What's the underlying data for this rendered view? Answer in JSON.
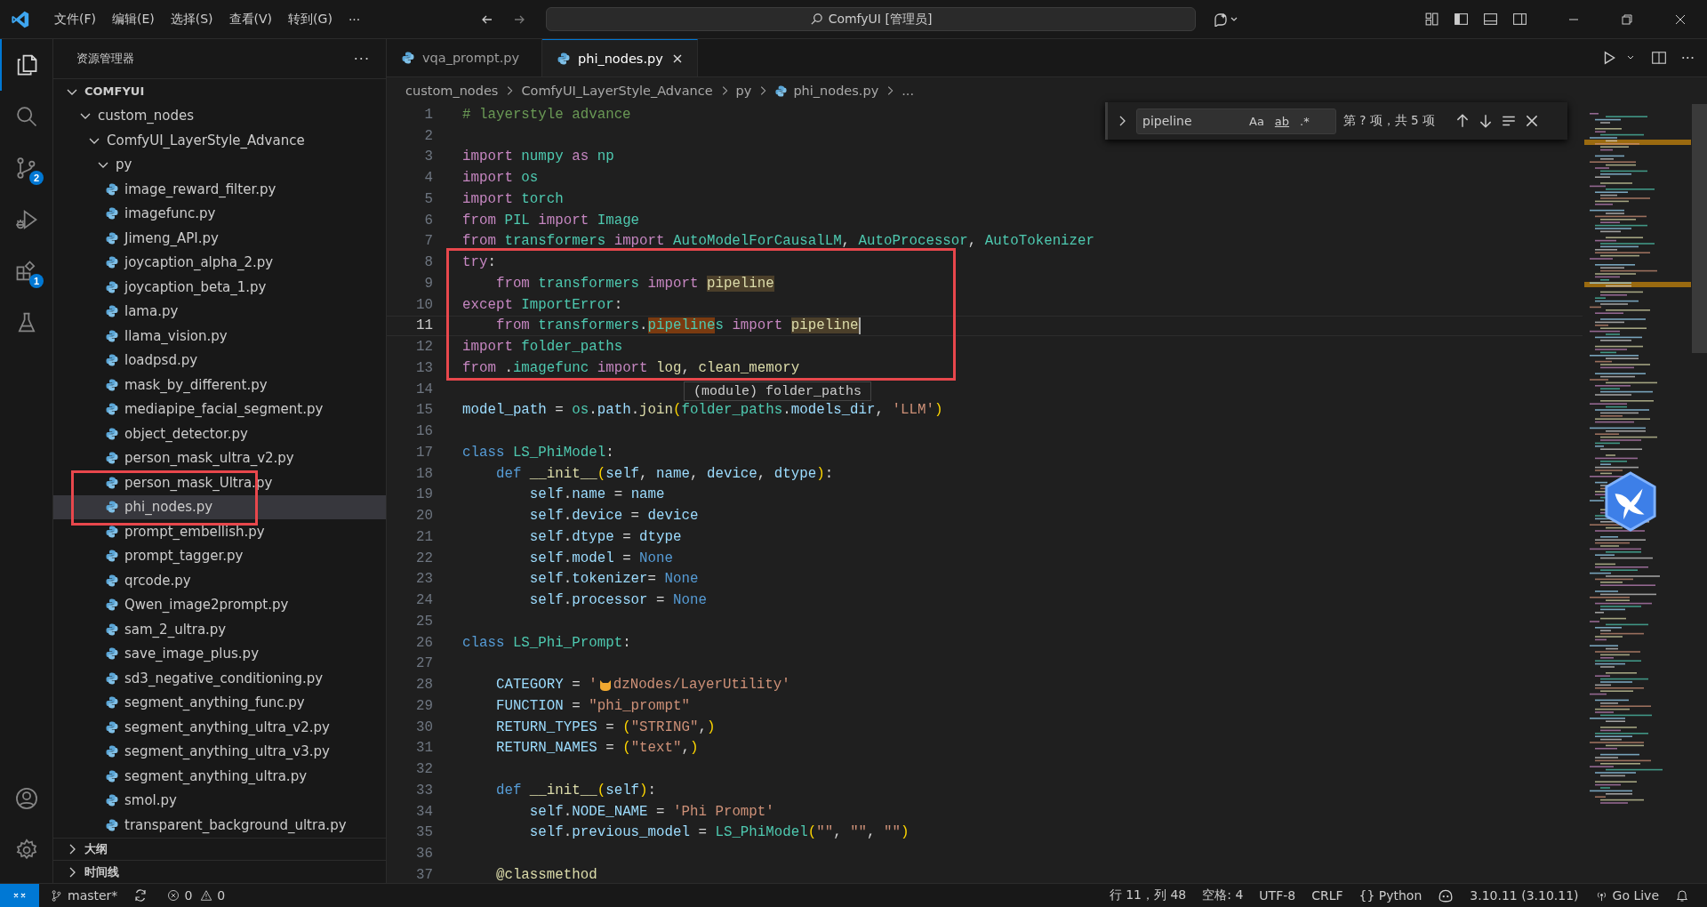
{
  "title_bar": {
    "menus": [
      "文件(F)",
      "编辑(E)",
      "选择(S)",
      "查看(V)",
      "转到(G)"
    ],
    "more": "···",
    "search": "ComfyUI [管理员]"
  },
  "activity_bar": {
    "items": [
      {
        "kind": "explorer",
        "selected": true
      },
      {
        "kind": "search",
        "selected": false
      },
      {
        "kind": "source-control",
        "selected": false,
        "badge": "2"
      },
      {
        "kind": "run-debug",
        "selected": false
      },
      {
        "kind": "extensions",
        "selected": false,
        "badge": "1"
      },
      {
        "kind": "testing",
        "selected": false
      }
    ],
    "bottom": [
      {
        "kind": "account"
      },
      {
        "kind": "settings"
      }
    ]
  },
  "sidebar": {
    "title": "资源管理器",
    "more": "···",
    "tree": [
      {
        "label": "COMFYUI",
        "expanded": true,
        "children": [
          {
            "label": "custom_nodes",
            "expanded": true,
            "children": [
              {
                "label": "ComfyUI_LayerStyle_Advance",
                "expanded": true,
                "children": [
                  {
                    "label": "py",
                    "expanded": true,
                    "children": [
                      {
                        "label": "image_reward_filter.py",
                        "selected": false
                      },
                      {
                        "label": "imagefunc.py",
                        "selected": false
                      },
                      {
                        "label": "Jimeng_API.py",
                        "selected": false
                      },
                      {
                        "label": "joycaption_alpha_2.py",
                        "selected": false
                      },
                      {
                        "label": "joycaption_beta_1.py",
                        "selected": false
                      },
                      {
                        "label": "lama.py",
                        "selected": false
                      },
                      {
                        "label": "llama_vision.py",
                        "selected": false
                      },
                      {
                        "label": "loadpsd.py",
                        "selected": false
                      },
                      {
                        "label": "mask_by_different.py",
                        "selected": false
                      },
                      {
                        "label": "mediapipe_facial_segment.py",
                        "selected": false
                      },
                      {
                        "label": "object_detector.py",
                        "selected": false
                      },
                      {
                        "label": "person_mask_ultra_v2.py",
                        "selected": false
                      },
                      {
                        "label": "person_mask_Ultra.py",
                        "selected": false
                      },
                      {
                        "label": "phi_nodes.py",
                        "selected": true
                      },
                      {
                        "label": "prompt_embellish.py",
                        "selected": false
                      },
                      {
                        "label": "prompt_tagger.py",
                        "selected": false
                      },
                      {
                        "label": "qrcode.py",
                        "selected": false
                      },
                      {
                        "label": "Qwen_image2prompt.py",
                        "selected": false
                      },
                      {
                        "label": "sam_2_ultra.py",
                        "selected": false
                      },
                      {
                        "label": "save_image_plus.py",
                        "selected": false
                      },
                      {
                        "label": "sd3_negative_conditioning.py",
                        "selected": false
                      },
                      {
                        "label": "segment_anything_func.py",
                        "selected": false
                      },
                      {
                        "label": "segment_anything_ultra_v2.py",
                        "selected": false
                      },
                      {
                        "label": "segment_anything_ultra_v3.py",
                        "selected": false
                      },
                      {
                        "label": "segment_anything_ultra.py",
                        "selected": false
                      },
                      {
                        "label": "smol.py",
                        "selected": false
                      },
                      {
                        "label": "transparent_background_ultra.py",
                        "selected": false
                      }
                    ]
                  }
                ]
              }
            ]
          }
        ]
      }
    ],
    "sections": [
      {
        "label": "大纲",
        "expanded": false
      },
      {
        "label": "时间线",
        "expanded": false
      }
    ]
  },
  "editor": {
    "tabs": [
      {
        "label": "vqa_prompt.py",
        "selected": false
      },
      {
        "label": "phi_nodes.py",
        "selected": true
      }
    ],
    "actions_more": "···",
    "breadcrumbs": [
      {
        "label": "custom_nodes",
        "kind": "folder"
      },
      {
        "label": "ComfyUI_LayerStyle_Advance",
        "kind": "folder"
      },
      {
        "label": "py",
        "kind": "folder"
      },
      {
        "label": "phi_nodes.py",
        "kind": "file"
      },
      {
        "label": "...",
        "kind": "more"
      }
    ],
    "find": {
      "value": "pipeline",
      "options": [
        {
          "label": "Aa",
          "on": false
        },
        {
          "label": "ab",
          "on": false
        },
        {
          "label": ".*",
          "on": false
        }
      ],
      "result": "第 ? 项，共 5 项"
    },
    "lines": [
      {
        "number": "1",
        "current": false,
        "tokens": [
          {
            "kind": "comment",
            "text": "# layerstyle advance"
          }
        ]
      },
      {
        "number": "2",
        "current": false
      },
      {
        "number": "3",
        "current": false,
        "tokens": [
          {
            "kind": "keyword",
            "text": "import "
          },
          {
            "kind": "type",
            "text": "numpy "
          },
          {
            "kind": "keyword",
            "text": "as "
          },
          {
            "kind": "type",
            "text": "np"
          }
        ]
      },
      {
        "number": "4",
        "current": false,
        "tokens": [
          {
            "kind": "keyword",
            "text": "import "
          },
          {
            "kind": "type",
            "text": "os"
          }
        ]
      },
      {
        "number": "5",
        "current": false,
        "tokens": [
          {
            "kind": "keyword",
            "text": "import "
          },
          {
            "kind": "type",
            "text": "torch"
          }
        ]
      },
      {
        "number": "6",
        "current": false,
        "tokens": [
          {
            "kind": "keyword",
            "text": "from "
          },
          {
            "kind": "type",
            "text": "PIL "
          },
          {
            "kind": "keyword",
            "text": "import "
          },
          {
            "kind": "type",
            "text": "Image"
          }
        ]
      },
      {
        "number": "7",
        "current": false,
        "tokens": [
          {
            "kind": "keyword",
            "text": "from "
          },
          {
            "kind": "type",
            "text": "transformers "
          },
          {
            "kind": "keyword",
            "text": "import "
          },
          {
            "kind": "type",
            "text": "AutoModelForCausalLM"
          },
          {
            "kind": "plain",
            "text": ", "
          },
          {
            "kind": "type",
            "text": "AutoProcessor"
          },
          {
            "kind": "plain",
            "text": ", "
          },
          {
            "kind": "type",
            "text": "AutoTokenizer"
          }
        ]
      },
      {
        "number": "8",
        "current": false,
        "tokens": [
          {
            "kind": "keyword",
            "text": "try"
          },
          {
            "kind": "plain",
            "text": ":"
          }
        ]
      },
      {
        "number": "9",
        "current": false,
        "tokens": [
          {
            "kind": "keyword",
            "text": "    from "
          },
          {
            "kind": "type",
            "text": "transformers "
          },
          {
            "kind": "keyword",
            "text": "import "
          },
          {
            "kind": "match",
            "text": "pipeline"
          }
        ]
      },
      {
        "number": "10",
        "current": false,
        "tokens": [
          {
            "kind": "keyword",
            "text": "except "
          },
          {
            "kind": "type",
            "text": "ImportError"
          },
          {
            "kind": "plain",
            "text": ":"
          }
        ]
      },
      {
        "number": "11",
        "current": true,
        "tokens": [
          {
            "kind": "keyword",
            "text": "    from "
          },
          {
            "kind": "type",
            "text": "transformers"
          },
          {
            "kind": "plain",
            "text": "."
          },
          {
            "kind": "current-match",
            "text": "pipeline"
          },
          {
            "kind": "type",
            "text": "s "
          },
          {
            "kind": "keyword",
            "text": "import "
          },
          {
            "kind": "match",
            "text": "pipeline"
          }
        ]
      },
      {
        "number": "12",
        "current": false,
        "tokens": [
          {
            "kind": "keyword",
            "text": "import "
          },
          {
            "kind": "type",
            "text": "folder_paths"
          }
        ]
      },
      {
        "number": "13",
        "current": false,
        "tokens": [
          {
            "kind": "keyword",
            "text": "from "
          },
          {
            "kind": "plain",
            "text": "."
          },
          {
            "kind": "type",
            "text": "imagefunc "
          },
          {
            "kind": "keyword",
            "text": "import "
          },
          {
            "kind": "function",
            "text": "log"
          },
          {
            "kind": "plain",
            "text": ", "
          },
          {
            "kind": "function",
            "text": "clean_memory"
          }
        ]
      },
      {
        "number": "14",
        "current": false
      },
      {
        "number": "15",
        "current": false,
        "tokens": [
          {
            "kind": "variable",
            "text": "model_path"
          },
          {
            "kind": "plain",
            "text": " = "
          },
          {
            "kind": "type",
            "text": "os"
          },
          {
            "kind": "plain",
            "text": "."
          },
          {
            "kind": "variable",
            "text": "path"
          },
          {
            "kind": "plain",
            "text": "."
          },
          {
            "kind": "function",
            "text": "join"
          },
          {
            "kind": "bracket",
            "text": "("
          },
          {
            "kind": "type",
            "text": "folder_paths"
          },
          {
            "kind": "plain",
            "text": "."
          },
          {
            "kind": "variable",
            "text": "models_dir"
          },
          {
            "kind": "plain",
            "text": ", "
          },
          {
            "kind": "string",
            "text": "'LLM'"
          },
          {
            "kind": "bracket",
            "text": ")"
          }
        ]
      },
      {
        "number": "16",
        "current": false
      },
      {
        "number": "17",
        "current": false,
        "tokens": [
          {
            "kind": "storage",
            "text": "class "
          },
          {
            "kind": "type",
            "text": "LS_PhiModel"
          },
          {
            "kind": "plain",
            "text": ":"
          }
        ]
      },
      {
        "number": "18",
        "current": false,
        "tokens": [
          {
            "kind": "storage",
            "text": "    def "
          },
          {
            "kind": "function",
            "text": "__init__"
          },
          {
            "kind": "bracket",
            "text": "("
          },
          {
            "kind": "variable",
            "text": "self"
          },
          {
            "kind": "plain",
            "text": ", "
          },
          {
            "kind": "variable",
            "text": "name"
          },
          {
            "kind": "plain",
            "text": ", "
          },
          {
            "kind": "variable",
            "text": "device"
          },
          {
            "kind": "plain",
            "text": ", "
          },
          {
            "kind": "variable",
            "text": "dtype"
          },
          {
            "kind": "bracket",
            "text": ")"
          },
          {
            "kind": "plain",
            "text": ":"
          }
        ]
      },
      {
        "number": "19",
        "current": false,
        "tokens": [
          {
            "kind": "variable",
            "text": "        self"
          },
          {
            "kind": "plain",
            "text": "."
          },
          {
            "kind": "variable",
            "text": "name"
          },
          {
            "kind": "plain",
            "text": " = "
          },
          {
            "kind": "variable",
            "text": "name"
          }
        ]
      },
      {
        "number": "20",
        "current": false,
        "tokens": [
          {
            "kind": "variable",
            "text": "        self"
          },
          {
            "kind": "plain",
            "text": "."
          },
          {
            "kind": "variable",
            "text": "device"
          },
          {
            "kind": "plain",
            "text": " = "
          },
          {
            "kind": "variable",
            "text": "device"
          }
        ]
      },
      {
        "number": "21",
        "current": false,
        "tokens": [
          {
            "kind": "variable",
            "text": "        self"
          },
          {
            "kind": "plain",
            "text": "."
          },
          {
            "kind": "variable",
            "text": "dtype"
          },
          {
            "kind": "plain",
            "text": " = "
          },
          {
            "kind": "variable",
            "text": "dtype"
          }
        ]
      },
      {
        "number": "22",
        "current": false,
        "tokens": [
          {
            "kind": "variable",
            "text": "        self"
          },
          {
            "kind": "plain",
            "text": "."
          },
          {
            "kind": "variable",
            "text": "model"
          },
          {
            "kind": "plain",
            "text": " = "
          },
          {
            "kind": "storage",
            "text": "None"
          }
        ]
      },
      {
        "number": "23",
        "current": false,
        "tokens": [
          {
            "kind": "variable",
            "text": "        self"
          },
          {
            "kind": "plain",
            "text": "."
          },
          {
            "kind": "variable",
            "text": "tokenizer"
          },
          {
            "kind": "plain",
            "text": "= "
          },
          {
            "kind": "storage",
            "text": "None"
          }
        ]
      },
      {
        "number": "24",
        "current": false,
        "tokens": [
          {
            "kind": "variable",
            "text": "        self"
          },
          {
            "kind": "plain",
            "text": "."
          },
          {
            "kind": "variable",
            "text": "processor"
          },
          {
            "kind": "plain",
            "text": " = "
          },
          {
            "kind": "storage",
            "text": "None"
          }
        ]
      },
      {
        "number": "25",
        "current": false
      },
      {
        "number": "26",
        "current": false,
        "tokens": [
          {
            "kind": "storage",
            "text": "class "
          },
          {
            "kind": "type",
            "text": "LS_Phi_Prompt"
          },
          {
            "kind": "plain",
            "text": ":"
          }
        ]
      },
      {
        "number": "27",
        "current": false
      },
      {
        "number": "28",
        "current": false,
        "tokens": [
          {
            "kind": "variable",
            "text": "    CATEGORY"
          },
          {
            "kind": "plain",
            "text": " = "
          },
          {
            "kind": "string",
            "text": "'"
          },
          {
            "kind": "cat-emoji"
          },
          {
            "kind": "string",
            "text": "dzNodes/LayerUtility'"
          }
        ]
      },
      {
        "number": "29",
        "current": false,
        "tokens": [
          {
            "kind": "variable",
            "text": "    FUNCTION"
          },
          {
            "kind": "plain",
            "text": " = "
          },
          {
            "kind": "string",
            "text": "\"phi_prompt\""
          }
        ]
      },
      {
        "number": "30",
        "current": false,
        "tokens": [
          {
            "kind": "variable",
            "text": "    RETURN_TYPES"
          },
          {
            "kind": "plain",
            "text": " = "
          },
          {
            "kind": "bracket",
            "text": "("
          },
          {
            "kind": "string",
            "text": "\"STRING\""
          },
          {
            "kind": "plain",
            "text": ","
          },
          {
            "kind": "bracket",
            "text": ")"
          }
        ]
      },
      {
        "number": "31",
        "current": false,
        "tokens": [
          {
            "kind": "variable",
            "text": "    RETURN_NAMES"
          },
          {
            "kind": "plain",
            "text": " = "
          },
          {
            "kind": "bracket",
            "text": "("
          },
          {
            "kind": "string",
            "text": "\"text\""
          },
          {
            "kind": "plain",
            "text": ","
          },
          {
            "kind": "bracket",
            "text": ")"
          }
        ]
      },
      {
        "number": "32",
        "current": false
      },
      {
        "number": "33",
        "current": false,
        "tokens": [
          {
            "kind": "storage",
            "text": "    def "
          },
          {
            "kind": "function",
            "text": "__init__"
          },
          {
            "kind": "bracket",
            "text": "("
          },
          {
            "kind": "variable",
            "text": "self"
          },
          {
            "kind": "bracket",
            "text": ")"
          },
          {
            "kind": "plain",
            "text": ":"
          }
        ]
      },
      {
        "number": "34",
        "current": false,
        "tokens": [
          {
            "kind": "variable",
            "text": "        self"
          },
          {
            "kind": "plain",
            "text": "."
          },
          {
            "kind": "variable",
            "text": "NODE_NAME"
          },
          {
            "kind": "plain",
            "text": " = "
          },
          {
            "kind": "string",
            "text": "'Phi Prompt'"
          }
        ]
      },
      {
        "number": "35",
        "current": false,
        "tokens": [
          {
            "kind": "variable",
            "text": "        self"
          },
          {
            "kind": "plain",
            "text": "."
          },
          {
            "kind": "variable",
            "text": "previous_model"
          },
          {
            "kind": "plain",
            "text": " = "
          },
          {
            "kind": "type",
            "text": "LS_PhiModel"
          },
          {
            "kind": "bracket",
            "text": "("
          },
          {
            "kind": "string",
            "text": "\"\""
          },
          {
            "kind": "plain",
            "text": ", "
          },
          {
            "kind": "string",
            "text": "\"\""
          },
          {
            "kind": "plain",
            "text": ", "
          },
          {
            "kind": "string",
            "text": "\"\""
          },
          {
            "kind": "bracket",
            "text": ")"
          }
        ]
      },
      {
        "number": "36",
        "current": false
      },
      {
        "number": "37",
        "current": false,
        "tokens": [
          {
            "kind": "function",
            "text": "    @classmethod"
          }
        ]
      }
    ],
    "hover": "(module) folder_paths"
  },
  "status_bar": {
    "branch": "master*",
    "errors": "0",
    "warnings": "0",
    "items": [
      "行 11，列 48",
      "空格: 4",
      "UTF-8",
      "CRLF"
    ],
    "language_icon": "{}",
    "language": "Python",
    "python_version": "3.10.11 (3.10.11)",
    "live": "Go Live"
  }
}
